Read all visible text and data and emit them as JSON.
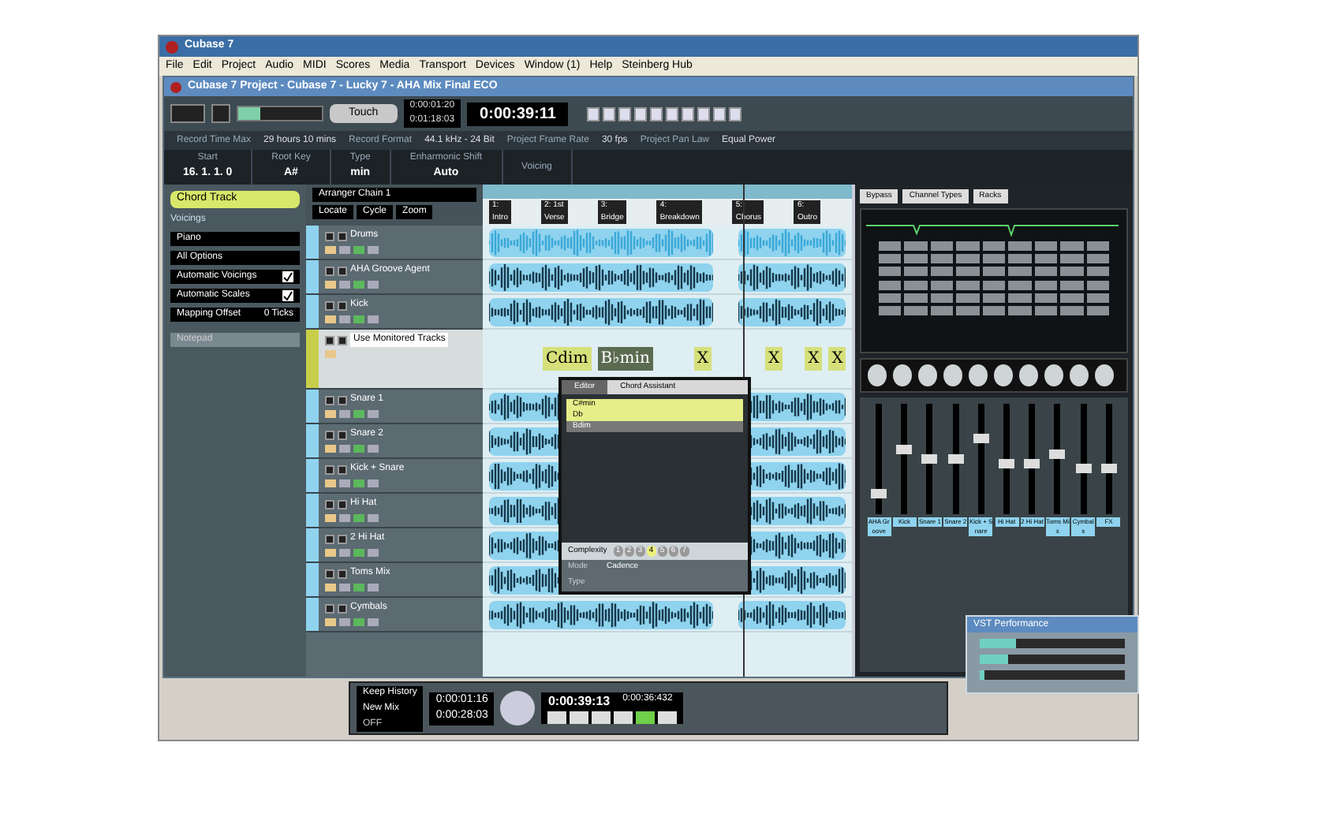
{
  "app_window": {
    "title": "Cubase 7"
  },
  "menu": [
    "File",
    "Edit",
    "Project",
    "Audio",
    "MIDI",
    "Scores",
    "Media",
    "Transport",
    "Devices",
    "Window (1)",
    "Help",
    "Steinberg Hub"
  ],
  "project_window": {
    "title": "Cubase 7 Project - Cubase 7 - Lucky 7 - AHA Mix Final ECO"
  },
  "toolbar": {
    "automation_mode": "Touch",
    "time_small_1": "0:00:01:20",
    "time_small_2": "0:01:18:03",
    "time_main": "0:00:39:11"
  },
  "info_line": [
    {
      "label": "Record Time Max",
      "value": "29 hours 10 mins"
    },
    {
      "label": "Record Format",
      "value": "44.1 kHz - 24 Bit"
    },
    {
      "label": "Project Frame Rate",
      "value": "30 fps"
    },
    {
      "label": "Project Pan Law",
      "value": "Equal Power"
    }
  ],
  "chord_info": [
    {
      "label": "Start",
      "value": "16. 1. 1. 0"
    },
    {
      "label": "Root Key",
      "value": "A#"
    },
    {
      "label": "Type",
      "value": "min"
    },
    {
      "label": "Enharmonic Shift",
      "value": "Auto"
    },
    {
      "label": "Voicing"
    }
  ],
  "inspector": {
    "track": "Chord Track",
    "section": "Voicings",
    "voicing": "Piano",
    "options": "All Options",
    "checks": [
      {
        "label": "Automatic Voicings",
        "checked": true
      },
      {
        "label": "Automatic Scales",
        "checked": true
      }
    ],
    "mapping_offset": {
      "label": "Mapping Offset",
      "value": "0 Ticks"
    },
    "notepad": "Notepad"
  },
  "track_list": {
    "arranger_chain": "Arranger Chain 1",
    "mode_1": "Locate",
    "mode_2": "Cycle",
    "mode_3": "Zoom",
    "tracks": [
      {
        "name": "Drums",
        "kind": "folder"
      },
      {
        "name": "AHA Groove Agent",
        "kind": "instrument"
      },
      {
        "name": "Kick",
        "kind": "audio"
      },
      {
        "name": "Use Monitored Tracks",
        "kind": "chord"
      },
      {
        "name": "Snare 1",
        "kind": "audio"
      },
      {
        "name": "Snare 2",
        "kind": "audio"
      },
      {
        "name": "Kick + Snare",
        "kind": "audio"
      },
      {
        "name": "Hi Hat",
        "kind": "audio"
      },
      {
        "name": "2 Hi Hat",
        "kind": "audio"
      },
      {
        "name": "Toms Mix",
        "kind": "audio"
      },
      {
        "name": "Cymbals",
        "kind": "audio"
      }
    ]
  },
  "arranger": [
    {
      "label": "1: Intro"
    },
    {
      "label": "2: 1st Verse"
    },
    {
      "label": "3: Bridge"
    },
    {
      "label": "4: Breakdown"
    },
    {
      "label": "5: Chorus"
    },
    {
      "label": "6: Outro"
    }
  ],
  "chords": [
    "Cdim",
    "B♭min",
    "X",
    "X",
    "X",
    "X"
  ],
  "chord_assistant": {
    "tabs": [
      {
        "label": "Editor",
        "selected": false
      },
      {
        "label": "Chord Assistant",
        "selected": true
      }
    ],
    "proposals": [
      {
        "label": "C#min",
        "selected": true
      },
      {
        "label": "Db",
        "selected": true
      },
      {
        "label": "Bdim",
        "selected": false
      }
    ],
    "complexity_label": "Complexity",
    "complexity": [
      {
        "label": "1",
        "selected": false
      },
      {
        "label": "2",
        "selected": false
      },
      {
        "label": "3",
        "selected": false
      },
      {
        "label": "4",
        "selected": true
      },
      {
        "label": "5",
        "selected": false
      },
      {
        "label": "6",
        "selected": false
      },
      {
        "label": "7",
        "selected": false
      }
    ],
    "mode": {
      "label": "Mode",
      "value": "Cadence"
    },
    "type": {
      "label": "Type"
    }
  },
  "mixer": {
    "buttons": [
      "Bypass",
      "Channel Types",
      "Racks"
    ],
    "channels": [
      {
        "name": "AHA Groove",
        "level": 0.15
      },
      {
        "name": "Kick",
        "level": 0.6
      },
      {
        "name": "Snare 1",
        "level": 0.5
      },
      {
        "name": "Snare 2",
        "level": 0.5
      },
      {
        "name": "Kick + Snare",
        "level": 0.7
      },
      {
        "name": "Hi Hat",
        "level": 0.45
      },
      {
        "name": "2 Hi Hat",
        "level": 0.45
      },
      {
        "name": "Toms Mix",
        "level": 0.55
      },
      {
        "name": "Cymbals",
        "level": 0.4
      },
      {
        "name": "FX",
        "level": 0.4
      }
    ]
  },
  "transport": {
    "history": "Keep History",
    "mix": "New Mix",
    "state": "OFF",
    "left_locator": "0:00:01:16",
    "right_locator": "0:00:28:03",
    "position": "0:00:39:13",
    "position_secondary": "0:00:36:432"
  },
  "vst_performance": {
    "title": "VST Performance",
    "meters": [
      {
        "level": 0.25
      },
      {
        "level": 0.2
      },
      {
        "level": 0.03
      }
    ]
  }
}
